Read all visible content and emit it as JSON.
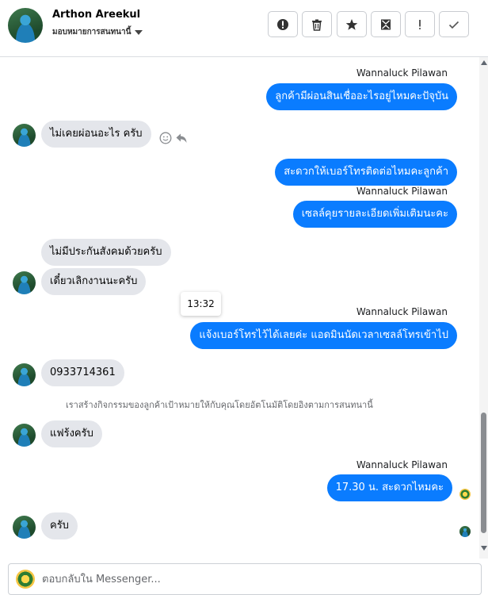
{
  "header": {
    "contact_name": "Arthon Areekul",
    "subtitle": "มอบหมายการสนทนานี้",
    "actions": [
      {
        "icon": "alert-circle-icon",
        "name": "spam-button"
      },
      {
        "icon": "trash-icon",
        "name": "delete-button"
      },
      {
        "icon": "star-icon",
        "name": "star-button"
      },
      {
        "icon": "archive-envelope-icon",
        "name": "archive-button"
      },
      {
        "icon": "exclamation-icon",
        "name": "follow-up-button"
      },
      {
        "icon": "check-icon",
        "name": "done-button"
      }
    ]
  },
  "thread": {
    "sender_name": "Wannaluck Pilawan",
    "messages": {
      "m1": "ลูกค้ามีผ่อนสินเชื่ออะไรอยู่ไหมคะปัจุบัน",
      "m2": "ไม่เคยผ่อนอะไร ครับ",
      "m3": "สะดวกให้เบอร์โทรติดต่อไหมคะลูกค้า",
      "m4": "เซลล์คุยรายละเอียดเพิ่มเติมนะคะ",
      "m5": "ไม่มีประกันสังคมด้วยครับ",
      "m6": "เดี๋ยวเลิกงานนะครับ",
      "m7": "แจ้งเบอร์โทรไว้ได้เลยค่ะ แอดมินนัดเวลาเซลล์โทรเข้าไป",
      "m8": "0933714361",
      "m9": "แฟร้งครับ",
      "m10": "17.30 น. สะดวกไหมคะ",
      "m11": "ครับ"
    },
    "timestamp": "13:32",
    "system_notice": "เราสร้างกิจกรรมของลูกค้าเป้าหมายให้กับคุณโดยอัตโนมัติโดยอิงตามการสนทนานี้"
  },
  "composer": {
    "placeholder": "ตอบกลับใน Messenger..."
  },
  "colors": {
    "outgoing_bubble": "#0a7cff",
    "incoming_bubble": "#e4e6eb"
  }
}
